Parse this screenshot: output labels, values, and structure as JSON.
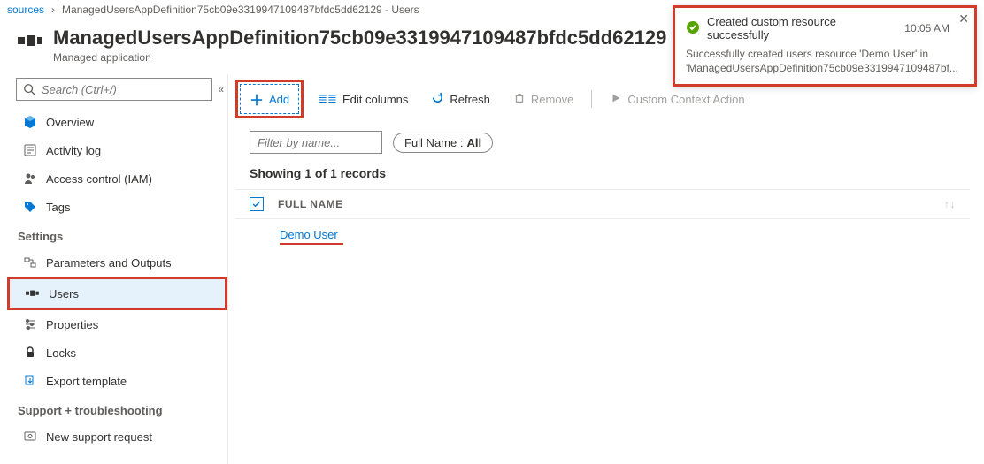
{
  "breadcrumb": {
    "root": "sources",
    "current": "ManagedUsersAppDefinition75cb09e3319947109487bfdc5dd62129 - Users"
  },
  "header": {
    "title": "ManagedUsersAppDefinition75cb09e3319947109487bfdc5dd62129 - Users",
    "subtitle": "Managed application"
  },
  "sidebar": {
    "search_placeholder": "Search (Ctrl+/)",
    "items": [
      {
        "label": "Overview"
      },
      {
        "label": "Activity log"
      },
      {
        "label": "Access control (IAM)"
      },
      {
        "label": "Tags"
      }
    ],
    "group_settings": "Settings",
    "settings_items": [
      {
        "label": "Parameters and Outputs"
      },
      {
        "label": "Users"
      },
      {
        "label": "Properties"
      },
      {
        "label": "Locks"
      },
      {
        "label": "Export template"
      }
    ],
    "group_support": "Support + troubleshooting",
    "support_items": [
      {
        "label": "New support request"
      }
    ]
  },
  "toolbar": {
    "add": "Add",
    "edit_columns": "Edit columns",
    "refresh": "Refresh",
    "remove": "Remove",
    "custom_action": "Custom Context Action"
  },
  "filters": {
    "filter_placeholder": "Filter by name...",
    "fullname_key": "Full Name :",
    "fullname_value": "All"
  },
  "records": {
    "summary": "Showing 1 of 1 records",
    "column_header": "FULL NAME",
    "rows": [
      {
        "name": "Demo User"
      }
    ]
  },
  "notification": {
    "title": "Created custom resource successfully",
    "time": "10:05 AM",
    "body": "Successfully created users resource 'Demo User' in 'ManagedUsersAppDefinition75cb09e3319947109487bf..."
  }
}
